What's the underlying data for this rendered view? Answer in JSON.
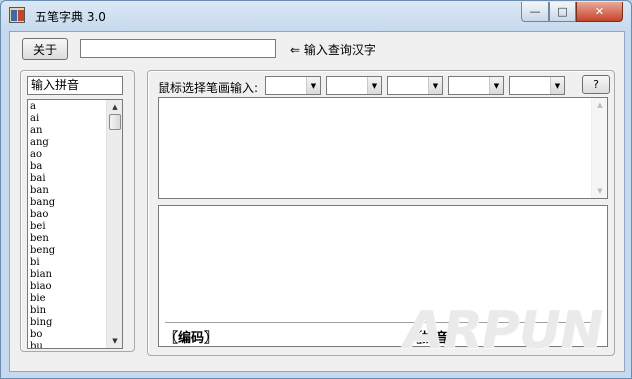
{
  "window": {
    "title": "五笔字典 3.0",
    "minimize_glyph": "—",
    "maximize_glyph": "□",
    "close_glyph": "✕"
  },
  "toolbar": {
    "about_label": "关于",
    "search_value": "",
    "search_placeholder": "",
    "hint_label": "⇐ 输入查询汉字"
  },
  "pinyin_panel": {
    "label": "输入拼音",
    "items": [
      "a",
      "ai",
      "an",
      "ang",
      "ao",
      "ba",
      "bai",
      "ban",
      "bang",
      "bao",
      "bei",
      "ben",
      "beng",
      "bi",
      "bian",
      "biao",
      "bie",
      "bin",
      "bing",
      "bo",
      "bu"
    ],
    "scroll_up_glyph": "▲",
    "scroll_down_glyph": "▼"
  },
  "stroke_panel": {
    "label": "鼠标选择笔画输入:",
    "selects": [
      {
        "value": "",
        "arrow": "▼"
      },
      {
        "value": "",
        "arrow": "▼"
      },
      {
        "value": "",
        "arrow": "▼"
      },
      {
        "value": "",
        "arrow": "▼"
      },
      {
        "value": "",
        "arrow": "▼"
      }
    ],
    "help_label": "?"
  },
  "results": {
    "scroll_up_glyph": "▲",
    "scroll_down_glyph": "▼"
  },
  "detail": {
    "code_label": "〖编码〗",
    "pinyin_label": "〖拼音〗"
  },
  "watermark": "ARPUN"
}
